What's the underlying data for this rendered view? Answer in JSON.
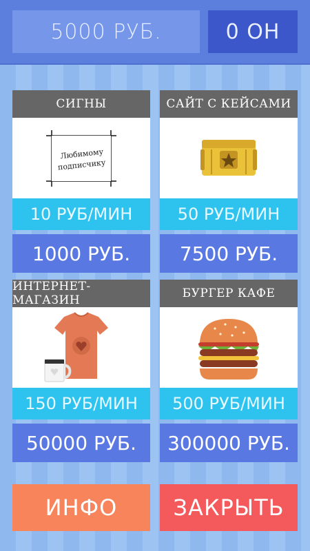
{
  "header": {
    "money": "5000 РУБ.",
    "rate": "0 ОН"
  },
  "businesses": [
    {
      "title": "СИГНЫ",
      "image_icon": "signature-paper-icon",
      "image_text_line1": "Любимому",
      "image_text_line2": "подписчику",
      "income": "10 РУБ/МИН",
      "price": "1000 РУБ."
    },
    {
      "title": "САЙТ С КЕЙСАМИ",
      "image_icon": "yellow-case-icon",
      "income": "50 РУБ/МИН",
      "price": "7500 РУБ."
    },
    {
      "title": "ИНТЕРНЕТ-МАГАЗИН",
      "image_icon": "tshirt-and-mug-icon",
      "income": "150 РУБ/МИН",
      "price": "50000 РУБ."
    },
    {
      "title": "БУРГЕР КАФЕ",
      "image_icon": "burger-icon",
      "income": "500 РУБ/МИН",
      "price": "300000 РУБ."
    }
  ],
  "buttons": {
    "info": "ИНФО",
    "close": "ЗАКРЫТЬ"
  },
  "colors": {
    "header_bg": "#5c7fde",
    "money_bg": "#7696ea",
    "rate_bg": "#3b57c9",
    "card_title_bg": "#666666",
    "income_bg": "#2ec3ee",
    "price_bg": "#5a78e2",
    "info_button": "#f7845a",
    "close_button": "#f4595b"
  }
}
